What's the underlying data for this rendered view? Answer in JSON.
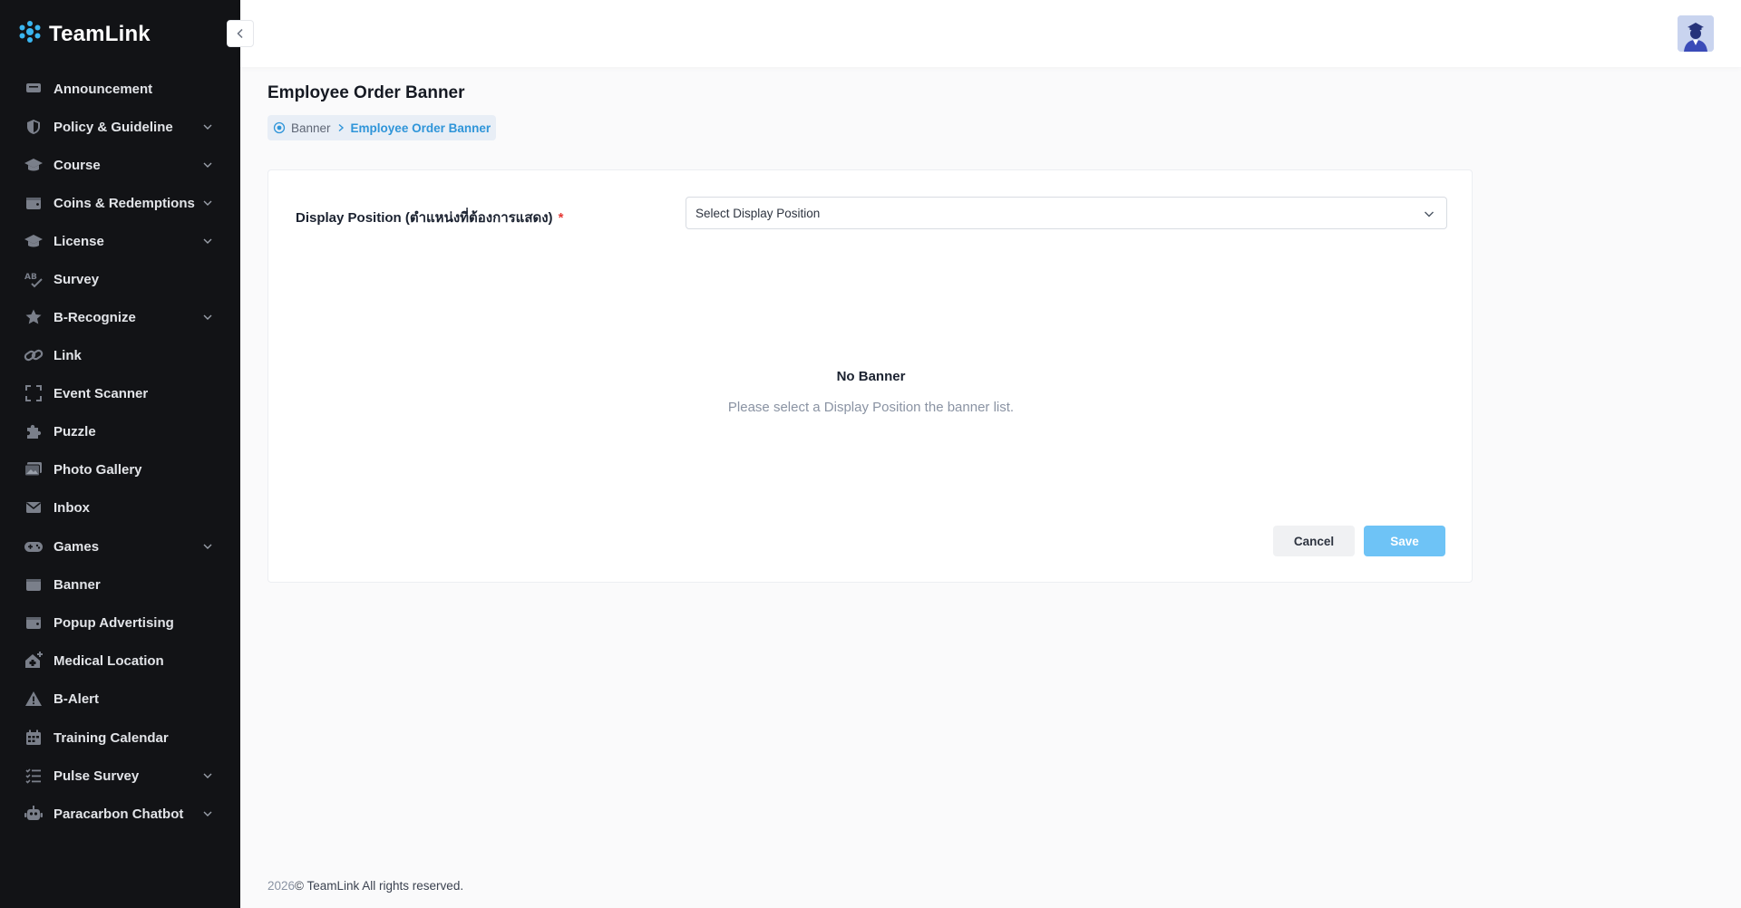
{
  "app": {
    "logo_text": "TeamLink"
  },
  "sidebar": {
    "items": [
      {
        "label": "Announcement",
        "icon": "announcement-icon",
        "expandable": false
      },
      {
        "label": "Policy & Guideline",
        "icon": "shield-icon",
        "expandable": true
      },
      {
        "label": "Course",
        "icon": "graduation-cap-icon",
        "expandable": true
      },
      {
        "label": "Coins & Redemptions",
        "icon": "wallet-icon",
        "expandable": true
      },
      {
        "label": "License",
        "icon": "graduation-cap-icon",
        "expandable": true
      },
      {
        "label": "Survey",
        "icon": "spellcheck-icon",
        "expandable": false
      },
      {
        "label": "B-Recognize",
        "icon": "star-icon",
        "expandable": true
      },
      {
        "label": "Link",
        "icon": "link-icon",
        "expandable": false
      },
      {
        "label": "Event Scanner",
        "icon": "scan-icon",
        "expandable": false
      },
      {
        "label": "Puzzle",
        "icon": "puzzle-icon",
        "expandable": false
      },
      {
        "label": "Photo Gallery",
        "icon": "photo-icon",
        "expandable": false
      },
      {
        "label": "Inbox",
        "icon": "mail-icon",
        "expandable": false
      },
      {
        "label": "Games",
        "icon": "gamepad-icon",
        "expandable": true
      },
      {
        "label": "Banner",
        "icon": "banner-icon",
        "expandable": false
      },
      {
        "label": "Popup Advertising",
        "icon": "wallet-icon",
        "expandable": false
      },
      {
        "label": "Medical Location",
        "icon": "medical-house-icon",
        "expandable": false
      },
      {
        "label": "B-Alert",
        "icon": "warning-icon",
        "expandable": false
      },
      {
        "label": "Training Calendar",
        "icon": "calendar-icon",
        "expandable": false
      },
      {
        "label": "Pulse Survey",
        "icon": "checklist-icon",
        "expandable": true
      },
      {
        "label": "Paracarbon Chatbot",
        "icon": "robot-icon",
        "expandable": true
      }
    ]
  },
  "page": {
    "title": "Employee Order Banner",
    "breadcrumb": {
      "home": "Banner",
      "current": "Employee Order Banner"
    }
  },
  "form": {
    "field_label": "Display Position (ตำแหน่งที่ต้องการแสดง)",
    "required_mark": "*",
    "select_value": "Select Display Position",
    "empty_title": "No Banner",
    "empty_subtitle": "Please select a Display Position the banner list.",
    "cancel_label": "Cancel",
    "save_label": "Save"
  },
  "footer": {
    "year": "2026",
    "copyright": "© TeamLink All rights reserved."
  },
  "colors": {
    "sidebar_bg": "#121316",
    "accent": "#2f95d9",
    "save_button": "#6ec3f6",
    "logo_icon": "#3ab6f0"
  }
}
